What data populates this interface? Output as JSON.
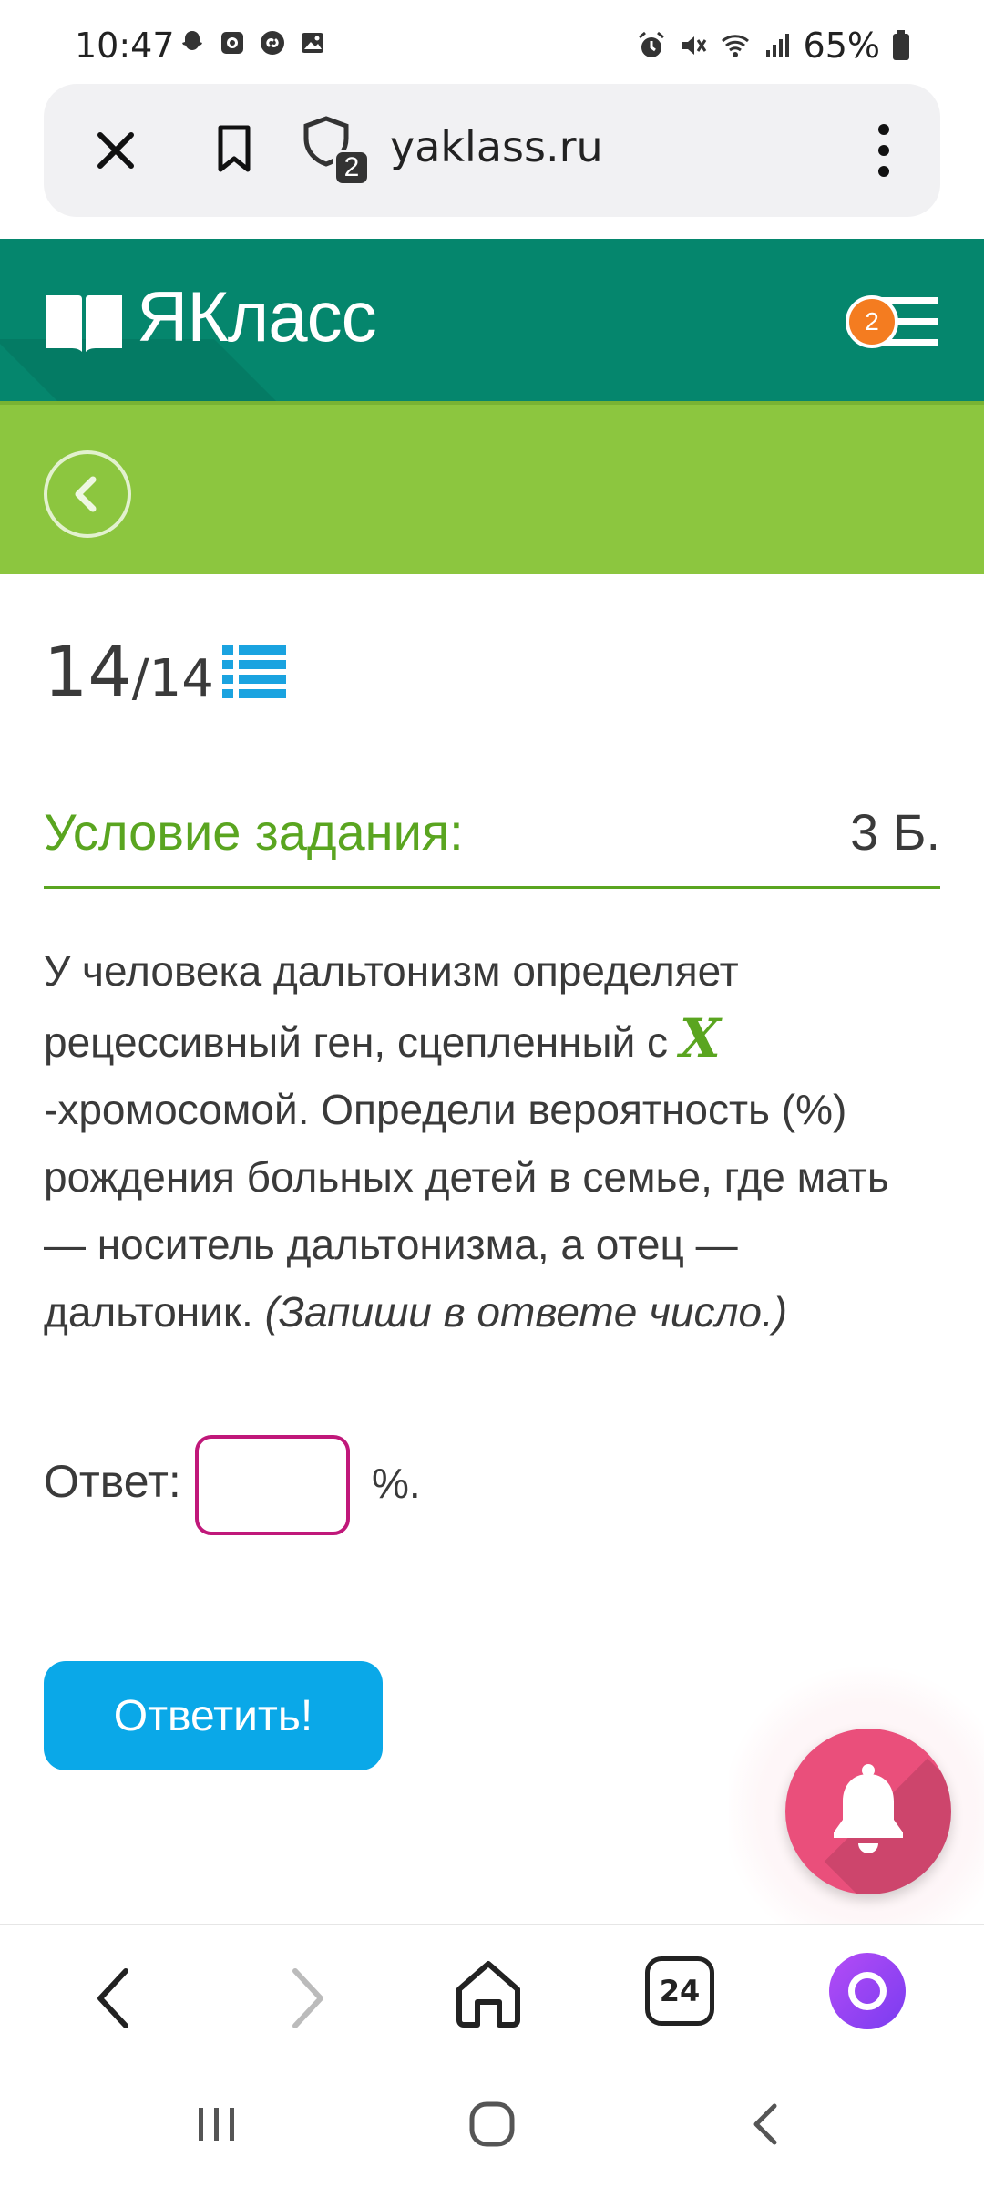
{
  "status_bar": {
    "time": "10:47",
    "battery": "65%"
  },
  "browser": {
    "url": "yaklass.ru",
    "tab_count_badge": "2",
    "tabs_count": "24"
  },
  "site": {
    "logo_text": "ЯКласс",
    "menu_badge": "2",
    "brand_color": "#05866d",
    "subheader_color": "#8cc63f"
  },
  "task": {
    "counter_current": "14",
    "counter_total": "/14",
    "title": "Условие задания:",
    "points": "3 Б.",
    "text_line1": "У человека дальтонизм определяет",
    "text_line2": "рецессивный ген, сцепленный с ",
    "variable": "X",
    "text_rest": "-хромосомой. Определи вероятность (%) рождения больных детей в семье, где мать — носитель дальтонизма, а отец — дальтоник. ",
    "hint": "(Запиши в ответе число.)",
    "answer_label": "Ответ:",
    "answer_value": "",
    "answer_unit": "%.",
    "submit_label": "Ответить!"
  },
  "icons": {
    "status_left": [
      "snapchat-icon",
      "camera-app-icon",
      "shazam-icon",
      "gallery-icon"
    ],
    "status_right": [
      "alarm-icon",
      "mute-icon",
      "wifi-icon",
      "signal-icon",
      "battery-icon"
    ],
    "toolbar": [
      "back-arrow-icon",
      "forward-arrow-icon",
      "home-icon",
      "tabs-icon",
      "alice-icon"
    ],
    "system": [
      "recents-icon",
      "home-circle-icon",
      "system-back-icon"
    ]
  }
}
